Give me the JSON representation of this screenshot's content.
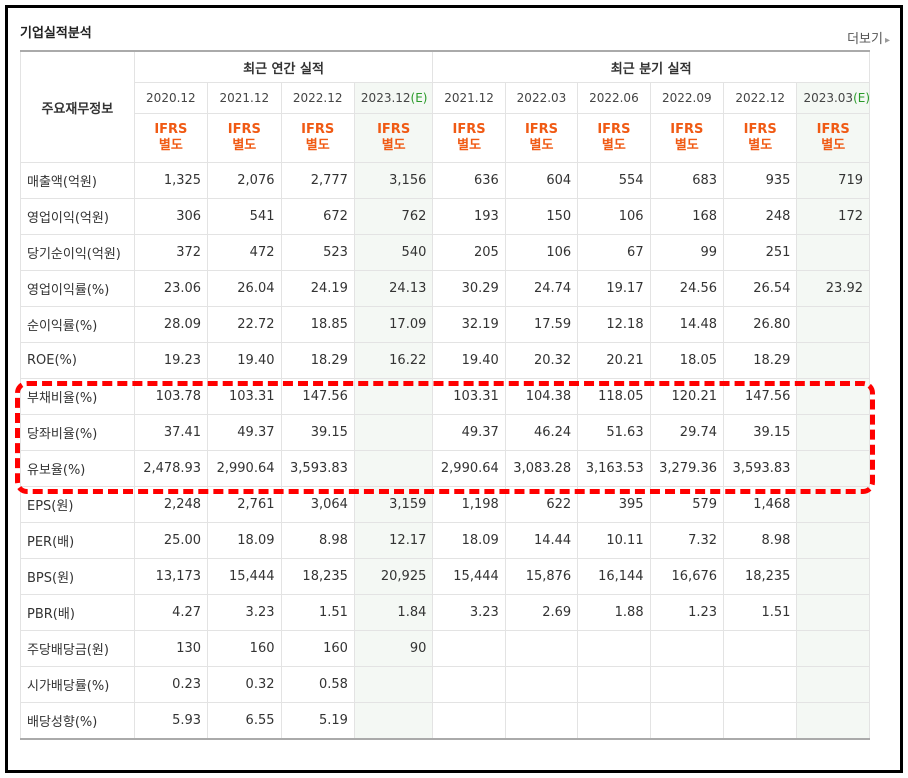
{
  "header": {
    "title": "기업실적분석",
    "more_label": "더보기",
    "more_arrow": "▸"
  },
  "table": {
    "main_label": "주요재무정보",
    "group_annual": "최근 연간 실적",
    "group_quarter": "최근 분기 실적",
    "periods": [
      {
        "date": "2020.12",
        "est": false
      },
      {
        "date": "2021.12",
        "est": false
      },
      {
        "date": "2022.12",
        "est": false
      },
      {
        "date": "2023.12",
        "est": true
      },
      {
        "date": "2021.12",
        "est": false
      },
      {
        "date": "2022.03",
        "est": false
      },
      {
        "date": "2022.06",
        "est": false
      },
      {
        "date": "2022.09",
        "est": false
      },
      {
        "date": "2022.12",
        "est": false
      },
      {
        "date": "2023.03",
        "est": true
      }
    ],
    "est_mark": "(E)",
    "ifrs_line1": "IFRS",
    "ifrs_line2": "별도",
    "rows": [
      {
        "label": "매출액(억원)",
        "values": [
          "1,325",
          "2,076",
          "2,777",
          "3,156",
          "636",
          "604",
          "554",
          "683",
          "935",
          "719"
        ]
      },
      {
        "label": "영업이익(억원)",
        "values": [
          "306",
          "541",
          "672",
          "762",
          "193",
          "150",
          "106",
          "168",
          "248",
          "172"
        ]
      },
      {
        "label": "당기순이익(억원)",
        "values": [
          "372",
          "472",
          "523",
          "540",
          "205",
          "106",
          "67",
          "99",
          "251",
          ""
        ]
      },
      {
        "label": "영업이익률(%)",
        "values": [
          "23.06",
          "26.04",
          "24.19",
          "24.13",
          "30.29",
          "24.74",
          "19.17",
          "24.56",
          "26.54",
          "23.92"
        ]
      },
      {
        "label": "순이익률(%)",
        "values": [
          "28.09",
          "22.72",
          "18.85",
          "17.09",
          "32.19",
          "17.59",
          "12.18",
          "14.48",
          "26.80",
          ""
        ]
      },
      {
        "label": "ROE(%)",
        "values": [
          "19.23",
          "19.40",
          "18.29",
          "16.22",
          "19.40",
          "20.32",
          "20.21",
          "18.05",
          "18.29",
          ""
        ]
      },
      {
        "label": "부채비율(%)",
        "values": [
          "103.78",
          "103.31",
          "147.56",
          "",
          "103.31",
          "104.38",
          "118.05",
          "120.21",
          "147.56",
          ""
        ]
      },
      {
        "label": "당좌비율(%)",
        "values": [
          "37.41",
          "49.37",
          "39.15",
          "",
          "49.37",
          "46.24",
          "51.63",
          "29.74",
          "39.15",
          ""
        ]
      },
      {
        "label": "유보율(%)",
        "values": [
          "2,478.93",
          "2,990.64",
          "3,593.83",
          "",
          "2,990.64",
          "3,083.28",
          "3,163.53",
          "3,279.36",
          "3,593.83",
          ""
        ]
      },
      {
        "label": "EPS(원)",
        "values": [
          "2,248",
          "2,761",
          "3,064",
          "3,159",
          "1,198",
          "622",
          "395",
          "579",
          "1,468",
          ""
        ]
      },
      {
        "label": "PER(배)",
        "values": [
          "25.00",
          "18.09",
          "8.98",
          "12.17",
          "18.09",
          "14.44",
          "10.11",
          "7.32",
          "8.98",
          ""
        ]
      },
      {
        "label": "BPS(원)",
        "values": [
          "13,173",
          "15,444",
          "18,235",
          "20,925",
          "15,444",
          "15,876",
          "16,144",
          "16,676",
          "18,235",
          ""
        ]
      },
      {
        "label": "PBR(배)",
        "values": [
          "4.27",
          "3.23",
          "1.51",
          "1.84",
          "3.23",
          "2.69",
          "1.88",
          "1.23",
          "1.51",
          ""
        ]
      },
      {
        "label": "주당배당금(원)",
        "values": [
          "130",
          "160",
          "160",
          "90",
          "",
          "",
          "",
          "",
          "",
          ""
        ]
      },
      {
        "label": "시가배당률(%)",
        "values": [
          "0.23",
          "0.32",
          "0.58",
          "",
          "",
          "",
          "",
          "",
          "",
          ""
        ]
      },
      {
        "label": "배당성향(%)",
        "values": [
          "5.93",
          "6.55",
          "5.19",
          "",
          "",
          "",
          "",
          "",
          "",
          ""
        ]
      }
    ]
  },
  "colors": {
    "ifrs": "#f05a14",
    "estimate_bg": "#f4f8f4",
    "estimate_mark": "#2a9a2a",
    "highlight": "#ff0000"
  }
}
